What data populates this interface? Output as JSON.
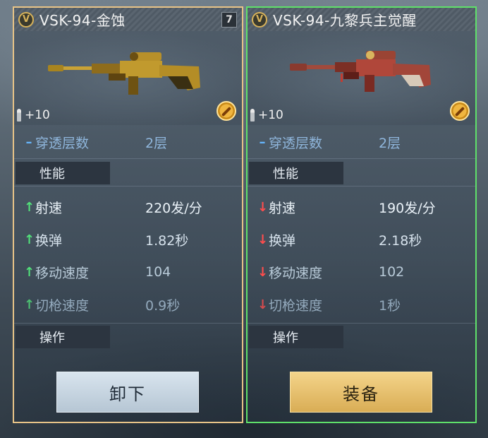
{
  "cards": [
    {
      "title": "VSK-94-金蚀",
      "badge": "V",
      "count": "7",
      "ammo": "+10",
      "penetration": {
        "label": "穿透层数",
        "value": "2层"
      },
      "section_performance": "性能",
      "stats": [
        {
          "label": "射速",
          "value": "220发/分",
          "trend": "up"
        },
        {
          "label": "换弹",
          "value": "1.82秒",
          "trend": "up"
        },
        {
          "label": "移动速度",
          "value": "104",
          "trend": "up"
        },
        {
          "label": "切枪速度",
          "value": "0.9秒",
          "trend": "up"
        }
      ],
      "section_handling": "操作",
      "button": "卸下"
    },
    {
      "title": "VSK-94-九黎兵主觉醒",
      "badge": "V",
      "ammo": "+10",
      "penetration": {
        "label": "穿透层数",
        "value": "2层"
      },
      "section_performance": "性能",
      "stats": [
        {
          "label": "射速",
          "value": "190发/分",
          "trend": "down"
        },
        {
          "label": "换弹",
          "value": "2.18秒",
          "trend": "down"
        },
        {
          "label": "移动速度",
          "value": "102",
          "trend": "down"
        },
        {
          "label": "切枪速度",
          "value": "1秒",
          "trend": "down"
        }
      ],
      "section_handling": "操作",
      "button": "装备"
    }
  ],
  "colors": {
    "left_border": "#e8c488",
    "right_border": "#5fe06a",
    "up": "#52e07a",
    "down": "#ff4d4d",
    "neutral": "#66b7ff"
  },
  "icons": {
    "badge": "v-rank-icon",
    "ammo": "bullet-icon",
    "no_attachment": "prohibited-icon",
    "up": "arrow-up-icon",
    "down": "arrow-down-icon"
  }
}
